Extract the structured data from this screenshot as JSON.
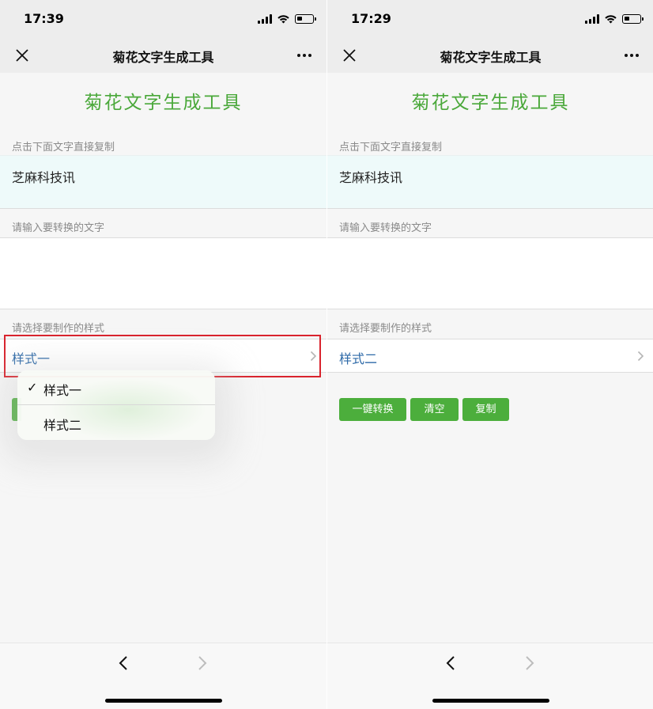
{
  "left_screen": {
    "status": {
      "time": "17:39"
    },
    "nav": {
      "title": "菊花文字生成工具"
    },
    "heading": "菊花文字生成工具",
    "copy_hint": "点击下面文字直接复制",
    "output_text": "芝麻科技讯",
    "input_label": "请输入要转换的文字",
    "style_label": "请选择要制作的样式",
    "selected_style": "样式一",
    "dropdown": {
      "options": [
        {
          "label": "样式一",
          "checked": true,
          "check": "✓"
        },
        {
          "label": "样式二",
          "checked": false
        }
      ]
    }
  },
  "right_screen": {
    "status": {
      "time": "17:29"
    },
    "nav": {
      "title": "菊花文字生成工具"
    },
    "heading": "菊花文字生成工具",
    "copy_hint": "点击下面文字直接复制",
    "output_text": "芝麻科技讯",
    "input_label": "请输入要转换的文字",
    "style_label": "请选择要制作的样式",
    "selected_style": "样式二",
    "buttons": {
      "convert": "一键转换",
      "clear": "清空",
      "copy": "复制"
    }
  },
  "colors": {
    "accent_green": "#4cae3c",
    "heading_green": "#4aa83a",
    "link_blue": "#2e6aa8",
    "highlight_red": "#d9232d",
    "output_bg": "#eefafa"
  },
  "icons": [
    "close-icon",
    "more-icon",
    "chevron-right-icon",
    "back-arrow-icon",
    "forward-arrow-icon",
    "signal-icon",
    "wifi-icon",
    "battery-icon",
    "check-icon"
  ]
}
